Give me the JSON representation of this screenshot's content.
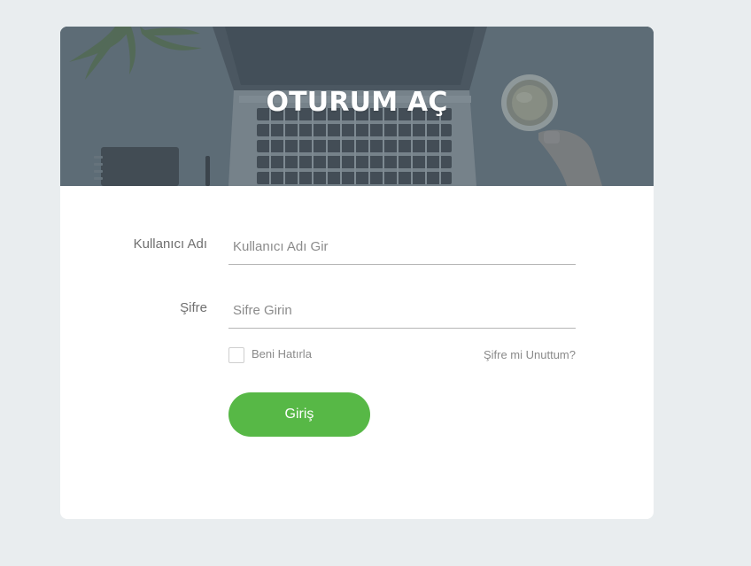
{
  "banner": {
    "title": "OTURUM AÇ"
  },
  "form": {
    "username": {
      "label": "Kullanıcı Adı",
      "placeholder": "Kullanıcı Adı Gir",
      "value": ""
    },
    "password": {
      "label": "Şifre",
      "placeholder": "Sifre Girin",
      "value": ""
    },
    "remember_label": "Beni Hatırla",
    "forgot_label": "Şifre mi Unuttum?",
    "submit_label": "Giriş"
  },
  "colors": {
    "page_background": "#e9edef",
    "card_background": "#ffffff",
    "button_accent": "#57b846",
    "banner_overlay": "#56656f"
  },
  "icons": {
    "banner_image": "laptop-desk-photo"
  }
}
